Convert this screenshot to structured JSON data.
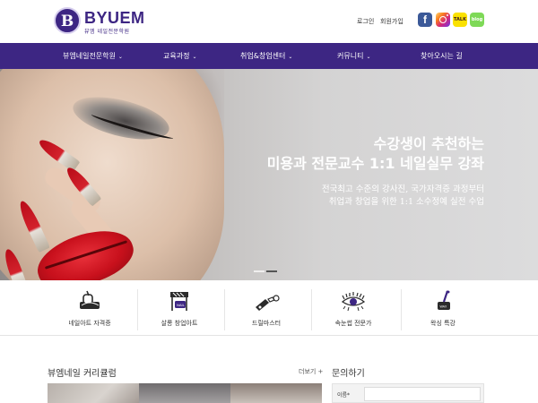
{
  "header": {
    "logo_mark": "B",
    "logo_text": "BYUEM",
    "logo_sub": "뷰엠 네일전문학원",
    "login": "로그인",
    "join": "회원가입",
    "sns": [
      {
        "name": "facebook-icon",
        "glyph": "f"
      },
      {
        "name": "instagram-icon",
        "glyph": ""
      },
      {
        "name": "kakaotalk-icon",
        "glyph": "TALK"
      },
      {
        "name": "blog-icon",
        "glyph": "blog"
      }
    ]
  },
  "nav": {
    "items": [
      {
        "label": "뷰엠네일전문학원",
        "chevron": "⌄"
      },
      {
        "label": "교육과정",
        "chevron": "⌄"
      },
      {
        "label": "취업&창업센터",
        "chevron": "⌄"
      },
      {
        "label": "커뮤니티",
        "chevron": "⌄"
      },
      {
        "label": "찾아오시는 길",
        "chevron": ""
      }
    ]
  },
  "hero": {
    "title_line1": "수강생이 추천하는",
    "title_line2": "미용과 전문교수 1:1 네일실무 강좌",
    "sub_line1": "전국최고 수준의 강사진, 국가자격증 과정부터",
    "sub_line2": "취업과 창업을 위한 1:1 소수정예 실전 수업",
    "slide_count": 2,
    "active_slide": 2
  },
  "services": [
    {
      "label": "네일아트 자격증",
      "icon": "nail-certificate-icon"
    },
    {
      "label": "살롱 창업아트",
      "icon": "salon-startup-icon"
    },
    {
      "label": "드릴마스터",
      "icon": "drill-master-icon"
    },
    {
      "label": "속눈썹 전문가",
      "icon": "eyelash-icon"
    },
    {
      "label": "왁싱 특강",
      "icon": "waxing-icon"
    }
  ],
  "curriculum": {
    "title": "뷰엠네일 커리큘럼",
    "more": "더보기 +"
  },
  "inquiry": {
    "title": "문의하기",
    "name_label": "이름*"
  },
  "colors": {
    "brand": "#3d2683",
    "nav_bg": "#3d2683",
    "accent_red": "#c8101c"
  }
}
